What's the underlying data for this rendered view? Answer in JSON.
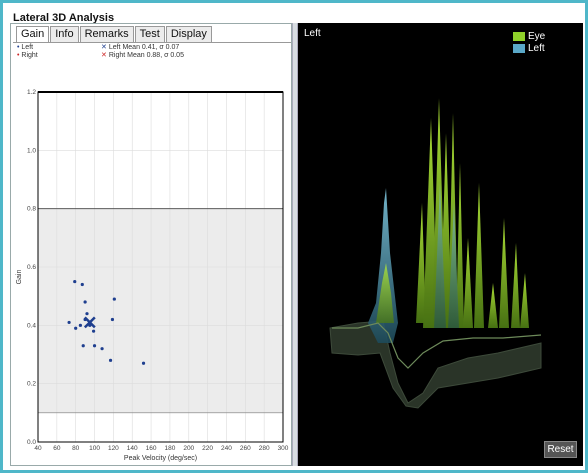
{
  "window": {
    "title": "Lateral 3D Analysis"
  },
  "tabs": [
    {
      "label": "Gain",
      "active": true
    },
    {
      "label": "Info",
      "active": false
    },
    {
      "label": "Remarks",
      "active": false
    },
    {
      "label": "Test",
      "active": false
    },
    {
      "label": "Display",
      "active": false
    }
  ],
  "legend": {
    "left_label": "Left",
    "right_label": "Right",
    "left_mean": "Left Mean 0.41, σ 0.07",
    "right_mean": "Right Mean 0.88, σ 0.05",
    "left_color": "#1f3f8f",
    "right_color": "#cc2222"
  },
  "chart_data": {
    "type": "scatter",
    "xlabel": "Peak Velocity (deg/sec)",
    "ylabel": "Gain",
    "xlim": [
      40,
      300
    ],
    "ylim": [
      0,
      1.2
    ],
    "xticks": [
      40,
      60,
      80,
      100,
      120,
      140,
      160,
      180,
      200,
      220,
      240,
      260,
      280,
      300
    ],
    "yticks": [
      0.0,
      0.2,
      0.4,
      0.6,
      0.8,
      1.0,
      1.2
    ],
    "normal_band": [
      0.1,
      0.8
    ],
    "series": [
      {
        "name": "Left",
        "points": [
          [
            79,
            0.55
          ],
          [
            87,
            0.54
          ],
          [
            90,
            0.48
          ],
          [
            121,
            0.49
          ],
          [
            73,
            0.41
          ],
          [
            80,
            0.39
          ],
          [
            85,
            0.4
          ],
          [
            90,
            0.42
          ],
          [
            92,
            0.44
          ],
          [
            95,
            0.4
          ],
          [
            99,
            0.38
          ],
          [
            88,
            0.33
          ],
          [
            100,
            0.33
          ],
          [
            108,
            0.32
          ],
          [
            119,
            0.42
          ],
          [
            117,
            0.28
          ],
          [
            152,
            0.27
          ]
        ]
      }
    ],
    "mean_marker": {
      "series": "Left",
      "x": 95,
      "y": 0.41
    }
  },
  "view3d": {
    "title": "Left",
    "legend": [
      {
        "label": "Eye",
        "color": "#8fd12a"
      },
      {
        "label": "Left",
        "color": "#5aa8c8"
      }
    ],
    "reset_label": "Reset"
  }
}
